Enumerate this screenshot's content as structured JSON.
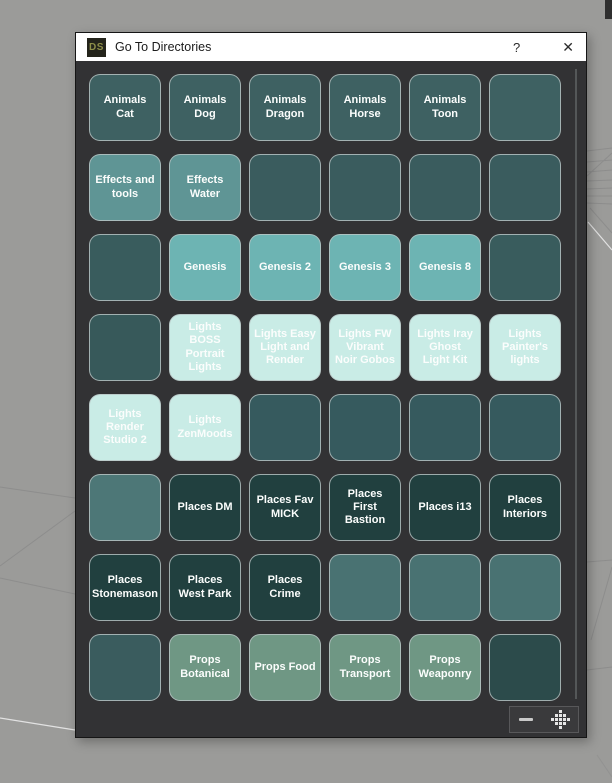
{
  "window": {
    "title": "Go To Directories",
    "app_badge": "DS",
    "help_label": "?",
    "close_label": "✕"
  },
  "footer": {
    "collapse_icon": "minimize-dash",
    "grip_icon": "dot-grid-handle"
  },
  "colors": {
    "viewport_bg": "#9b9b99",
    "dialog_bg": "#323234",
    "titlebar_bg": "#ffffff",
    "button_text": "#fbfdfc",
    "button_border": "#bac6c5",
    "gridline": "#8b8b8b",
    "gridline_bright": "#e2e2e2",
    "dark_teal": "#3e6162",
    "lit_teal": "#5f9595",
    "genesis_teal": "#6db4b3",
    "light_mint": "#c9ece6",
    "places_dark": "#21403f",
    "props_sage": "#6f9784"
  },
  "grid": {
    "rows": [
      {
        "buttons": [
          {
            "label": "Animals\nCat",
            "bg": "#3e6162"
          },
          {
            "label": "Animals\nDog",
            "bg": "#3e6162"
          },
          {
            "label": "Animals\nDragon",
            "bg": "#3e6162"
          },
          {
            "label": "Animals\nHorse",
            "bg": "#3e6162"
          },
          {
            "label": "Animals\nToon",
            "bg": "#3e6162"
          },
          {
            "label": "",
            "bg": "#3e6162"
          }
        ]
      },
      {
        "buttons": [
          {
            "label": "Effects and\ntools",
            "bg": "#5f9595"
          },
          {
            "label": "Effects\nWater",
            "bg": "#5f9595"
          },
          {
            "label": "",
            "bg": "#3a5c5e"
          },
          {
            "label": "",
            "bg": "#3a5c5e"
          },
          {
            "label": "",
            "bg": "#3a5c5e"
          },
          {
            "label": "",
            "bg": "#3a5c5e"
          }
        ]
      },
      {
        "buttons": [
          {
            "label": "",
            "bg": "#395c5d"
          },
          {
            "label": "Genesis",
            "bg": "#6db4b3"
          },
          {
            "label": "Genesis 2",
            "bg": "#6db4b3"
          },
          {
            "label": "Genesis 3",
            "bg": "#6db4b3"
          },
          {
            "label": "Genesis 8",
            "bg": "#6db4b3"
          },
          {
            "label": "",
            "bg": "#395c5d"
          }
        ]
      },
      {
        "buttons": [
          {
            "label": "",
            "bg": "#37595a"
          },
          {
            "label": "Lights\nBOSS\nPortrait\nLights",
            "bg": "#c9ece6"
          },
          {
            "label": "Lights Easy\nLight and\nRender",
            "bg": "#c9ece6"
          },
          {
            "label": "Lights FW\nVibrant\nNoir Gobos",
            "bg": "#c9ece6"
          },
          {
            "label": "Lights Iray\nGhost\nLight Kit",
            "bg": "#c9ece6"
          },
          {
            "label": "Lights\nPainter's\nlights",
            "bg": "#c9ece6"
          }
        ]
      },
      {
        "buttons": [
          {
            "label": "Lights\nRender\nStudio 2",
            "bg": "#c9ece6"
          },
          {
            "label": "Lights\nZenMoods",
            "bg": "#c9ece6"
          },
          {
            "label": "",
            "bg": "#365a5e"
          },
          {
            "label": "",
            "bg": "#365a5e"
          },
          {
            "label": "",
            "bg": "#365a5e"
          },
          {
            "label": "",
            "bg": "#365a5e"
          }
        ]
      },
      {
        "buttons": [
          {
            "label": "",
            "bg": "#4d7777"
          },
          {
            "label": "Places DM",
            "bg": "#21403f"
          },
          {
            "label": "Places Fav\nMICK",
            "bg": "#21403f"
          },
          {
            "label": "Places\nFirst\nBastion",
            "bg": "#21403f"
          },
          {
            "label": "Places i13",
            "bg": "#21403f"
          },
          {
            "label": "Places\nInteriors",
            "bg": "#21403f"
          }
        ]
      },
      {
        "buttons": [
          {
            "label": "Places\nStonemason",
            "bg": "#21403f"
          },
          {
            "label": "Places\nWest Park",
            "bg": "#21403f"
          },
          {
            "label": "Places\nCrime",
            "bg": "#21403f"
          },
          {
            "label": "",
            "bg": "#497272"
          },
          {
            "label": "",
            "bg": "#497272"
          },
          {
            "label": "",
            "bg": "#497272"
          }
        ]
      },
      {
        "buttons": [
          {
            "label": "",
            "bg": "#3a5c5e"
          },
          {
            "label": "Props\nBotanical",
            "bg": "#6f9784"
          },
          {
            "label": "Props Food",
            "bg": "#6f9784"
          },
          {
            "label": "Props\nTransport",
            "bg": "#6f9784"
          },
          {
            "label": "Props\nWeaponry",
            "bg": "#6f9784"
          },
          {
            "label": "",
            "bg": "#2c4b4b"
          }
        ]
      }
    ]
  }
}
